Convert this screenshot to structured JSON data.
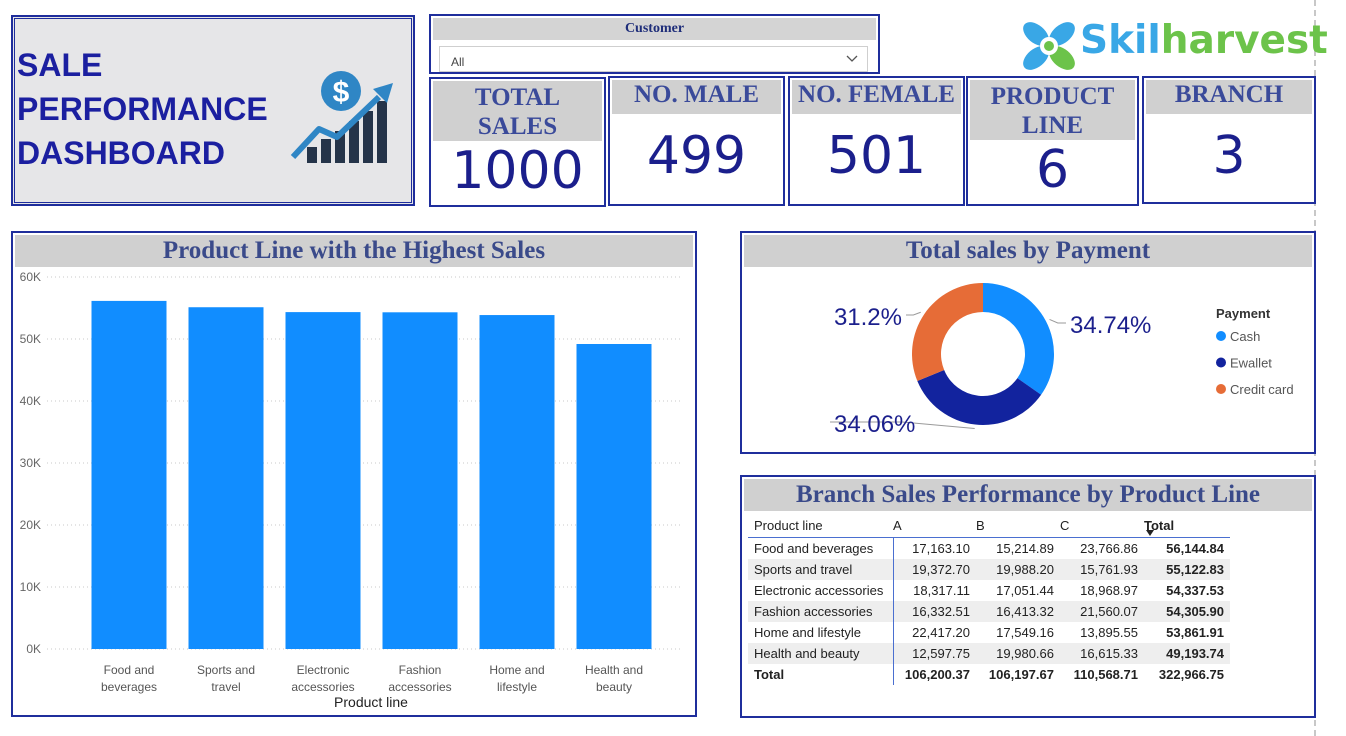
{
  "dashboard": {
    "title": "SALE\nPERFORMANCE\nDASHBOARD"
  },
  "slicer": {
    "label": "Customer",
    "value": "All"
  },
  "logo": {
    "prefix": "Skil",
    "suffix": "harvest"
  },
  "kpis": [
    {
      "label": "TOTAL SALES",
      "value": "1000"
    },
    {
      "label": "NO. MALE",
      "value": "499"
    },
    {
      "label": "NO. FEMALE",
      "value": "501"
    },
    {
      "label": "PRODUCT LINE",
      "value": "6"
    },
    {
      "label": "BRANCH",
      "value": "3"
    }
  ],
  "colors": {
    "accent": "#1f2e9c",
    "bar": "#118dff",
    "cash": "#118dff",
    "ewallet": "#12239e",
    "credit": "#e66c37"
  },
  "chart_data": [
    {
      "type": "bar",
      "title": "Product Line with the Highest Sales",
      "xlabel": "Product line",
      "ylabel": "",
      "categories": [
        "Food and beverages",
        "Sports and travel",
        "Electronic accessories",
        "Fashion accessories",
        "Home and lifestyle",
        "Health and beauty"
      ],
      "category_lines": [
        [
          "Food and",
          "beverages"
        ],
        [
          "Sports and",
          "travel"
        ],
        [
          "Electronic",
          "accessories"
        ],
        [
          "Fashion",
          "accessories"
        ],
        [
          "Home and",
          "lifestyle"
        ],
        [
          "Health and",
          "beauty"
        ]
      ],
      "values": [
        56144.84,
        55122.83,
        54337.53,
        54305.9,
        53861.91,
        49193.74
      ],
      "ylim": [
        0,
        60000
      ],
      "yticks": [
        0,
        10000,
        20000,
        30000,
        40000,
        50000,
        60000
      ],
      "ytick_labels": [
        "0K",
        "10K",
        "20K",
        "30K",
        "40K",
        "50K",
        "60K"
      ],
      "grid": true
    },
    {
      "type": "pie",
      "title": "Total sales by Payment",
      "legend_title": "Payment",
      "legend_position": "right",
      "labels": [
        "Cash",
        "Ewallet",
        "Credit card"
      ],
      "values": [
        34.74,
        34.06,
        31.2
      ],
      "value_labels": [
        "34.74%",
        "34.06%",
        "31.2%"
      ],
      "donut": true
    },
    {
      "type": "table",
      "title": "Branch Sales Performance by Product Line",
      "columns": [
        "Product line",
        "A",
        "B",
        "C",
        "Total"
      ],
      "rows": [
        [
          "Food and beverages",
          "17,163.10",
          "15,214.89",
          "23,766.86",
          "56,144.84"
        ],
        [
          "Sports and travel",
          "19,372.70",
          "19,988.20",
          "15,761.93",
          "55,122.83"
        ],
        [
          "Electronic accessories",
          "18,317.11",
          "17,051.44",
          "18,968.97",
          "54,337.53"
        ],
        [
          "Fashion accessories",
          "16,332.51",
          "16,413.32",
          "21,560.07",
          "54,305.90"
        ],
        [
          "Home and lifestyle",
          "22,417.20",
          "17,549.16",
          "13,895.55",
          "53,861.91"
        ],
        [
          "Health and beauty",
          "12,597.75",
          "19,980.66",
          "16,615.33",
          "49,193.74"
        ]
      ],
      "total_row": [
        "Total",
        "106,200.37",
        "106,197.67",
        "110,568.71",
        "322,966.75"
      ]
    }
  ]
}
